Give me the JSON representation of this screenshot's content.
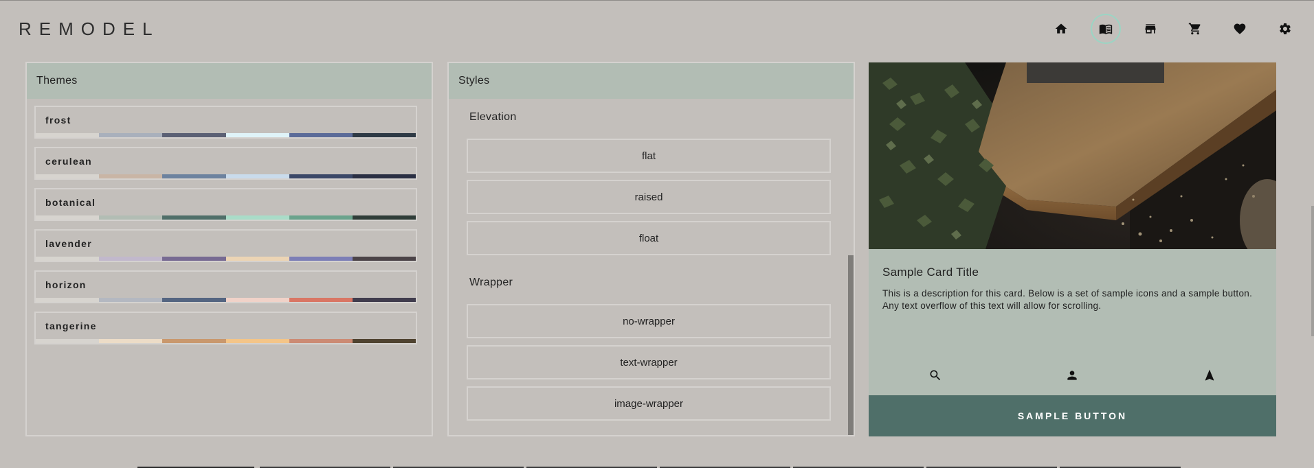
{
  "app": {
    "logo": "REMODEL"
  },
  "nav": {
    "items": [
      {
        "name": "home",
        "icon": "home-icon",
        "active": false
      },
      {
        "name": "book",
        "icon": "book-icon",
        "active": true
      },
      {
        "name": "store",
        "icon": "store-icon",
        "active": false
      },
      {
        "name": "cart",
        "icon": "cart-icon",
        "active": false
      },
      {
        "name": "favorites",
        "icon": "heart-icon",
        "active": false
      },
      {
        "name": "settings",
        "icon": "gear-icon",
        "active": false
      }
    ]
  },
  "themes": {
    "title": "Themes",
    "items": [
      {
        "name": "frost",
        "colors": [
          "#d7d4cf",
          "#a9b0bc",
          "#5b6074",
          "#dff3f8",
          "#5b6b99",
          "#2e3a45"
        ]
      },
      {
        "name": "cerulean",
        "colors": [
          "#d7d4cf",
          "#c9b5a5",
          "#6c829f",
          "#c9dbec",
          "#3a4767",
          "#2a2f43"
        ]
      },
      {
        "name": "botanical",
        "colors": [
          "#d7d4cf",
          "#b2bdb4",
          "#4f6f69",
          "#a9dcc8",
          "#6aa38c",
          "#2f3d38"
        ]
      },
      {
        "name": "lavender",
        "colors": [
          "#d7d4cf",
          "#c1b8cc",
          "#776a92",
          "#ecd4b4",
          "#7c7eb6",
          "#4b4347"
        ]
      },
      {
        "name": "horizon",
        "colors": [
          "#d7d4cf",
          "#b4b8c1",
          "#546581",
          "#f0d2c8",
          "#d97664",
          "#403c4d"
        ]
      },
      {
        "name": "tangerine",
        "colors": [
          "#d7d4cf",
          "#ecdcc7",
          "#c9986d",
          "#f4c588",
          "#cc8b74",
          "#4f4330"
        ]
      }
    ]
  },
  "styles": {
    "title": "Styles",
    "elevation": {
      "title": "Elevation",
      "options": [
        {
          "label": "flat",
          "selected": true
        },
        {
          "label": "raised",
          "selected": false
        },
        {
          "label": "float",
          "selected": false
        }
      ]
    },
    "wrapper": {
      "title": "Wrapper",
      "options": [
        {
          "label": "no-wrapper",
          "selected": true
        },
        {
          "label": "text-wrapper",
          "selected": false
        },
        {
          "label": "image-wrapper",
          "selected": false
        }
      ]
    }
  },
  "card": {
    "title": "Sample Card Title",
    "description": "This is a description for this card. Below is a set of sample icons and a sample button. Any text overflow of this text will allow for scrolling.",
    "icons": [
      "search-icon",
      "person-icon",
      "navigation-icon"
    ],
    "button_label": "SAMPLE BUTTON"
  },
  "colors": {
    "background": "#c3bfbb",
    "panel_header": "#b2bdb4",
    "accent": "#4f6f69",
    "active_ring": "#9bd5c4"
  }
}
